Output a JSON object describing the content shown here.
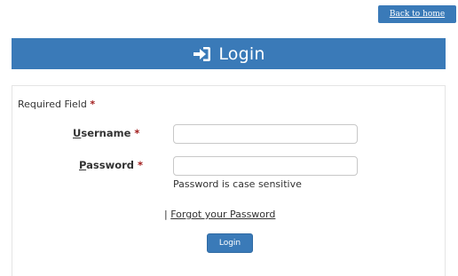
{
  "nav": {
    "back_to_home": "Back to home"
  },
  "header": {
    "icon": "sign-in-icon",
    "title": "Login"
  },
  "form": {
    "required_field_label": "Required Field",
    "required_marker": "*",
    "username": {
      "label_underlined": "U",
      "label_rest": "sername",
      "value": "",
      "placeholder": ""
    },
    "password": {
      "label_underlined": "P",
      "label_rest": "assword",
      "value": "",
      "placeholder": "",
      "hint": "Password is case sensitive"
    },
    "forgot_separator": "|",
    "forgot_password": "Forgot your Password",
    "submit_label": "Login"
  },
  "colors": {
    "primary": "#3a7ab8",
    "required_star": "#a11c1c"
  }
}
